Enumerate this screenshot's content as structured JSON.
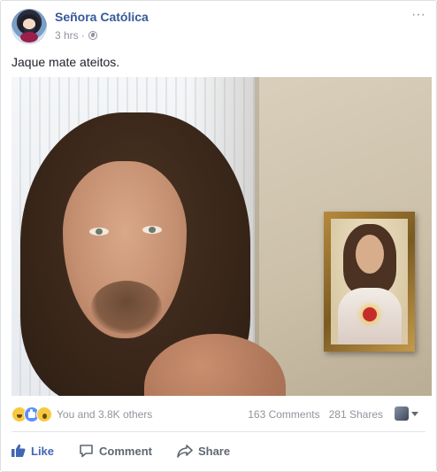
{
  "post": {
    "page_name": "Señora Católica",
    "time": "3 hrs",
    "separator": "·",
    "privacy_icon": "globe-icon",
    "more_icon": "more-options-icon",
    "text": "Jaque mate ateitos."
  },
  "photo": {
    "subject": "post-photo"
  },
  "reactions": {
    "icons": [
      "haha-icon",
      "like-icon",
      "wow-icon"
    ],
    "summary": "You and 3.8K others",
    "comments": "163 Comments",
    "shares": "281 Shares"
  },
  "actions": {
    "like": "Like",
    "comment": "Comment",
    "share": "Share"
  },
  "colors": {
    "link": "#365899",
    "like_active": "#4267b2",
    "muted": "#90949c",
    "action": "#606770"
  }
}
